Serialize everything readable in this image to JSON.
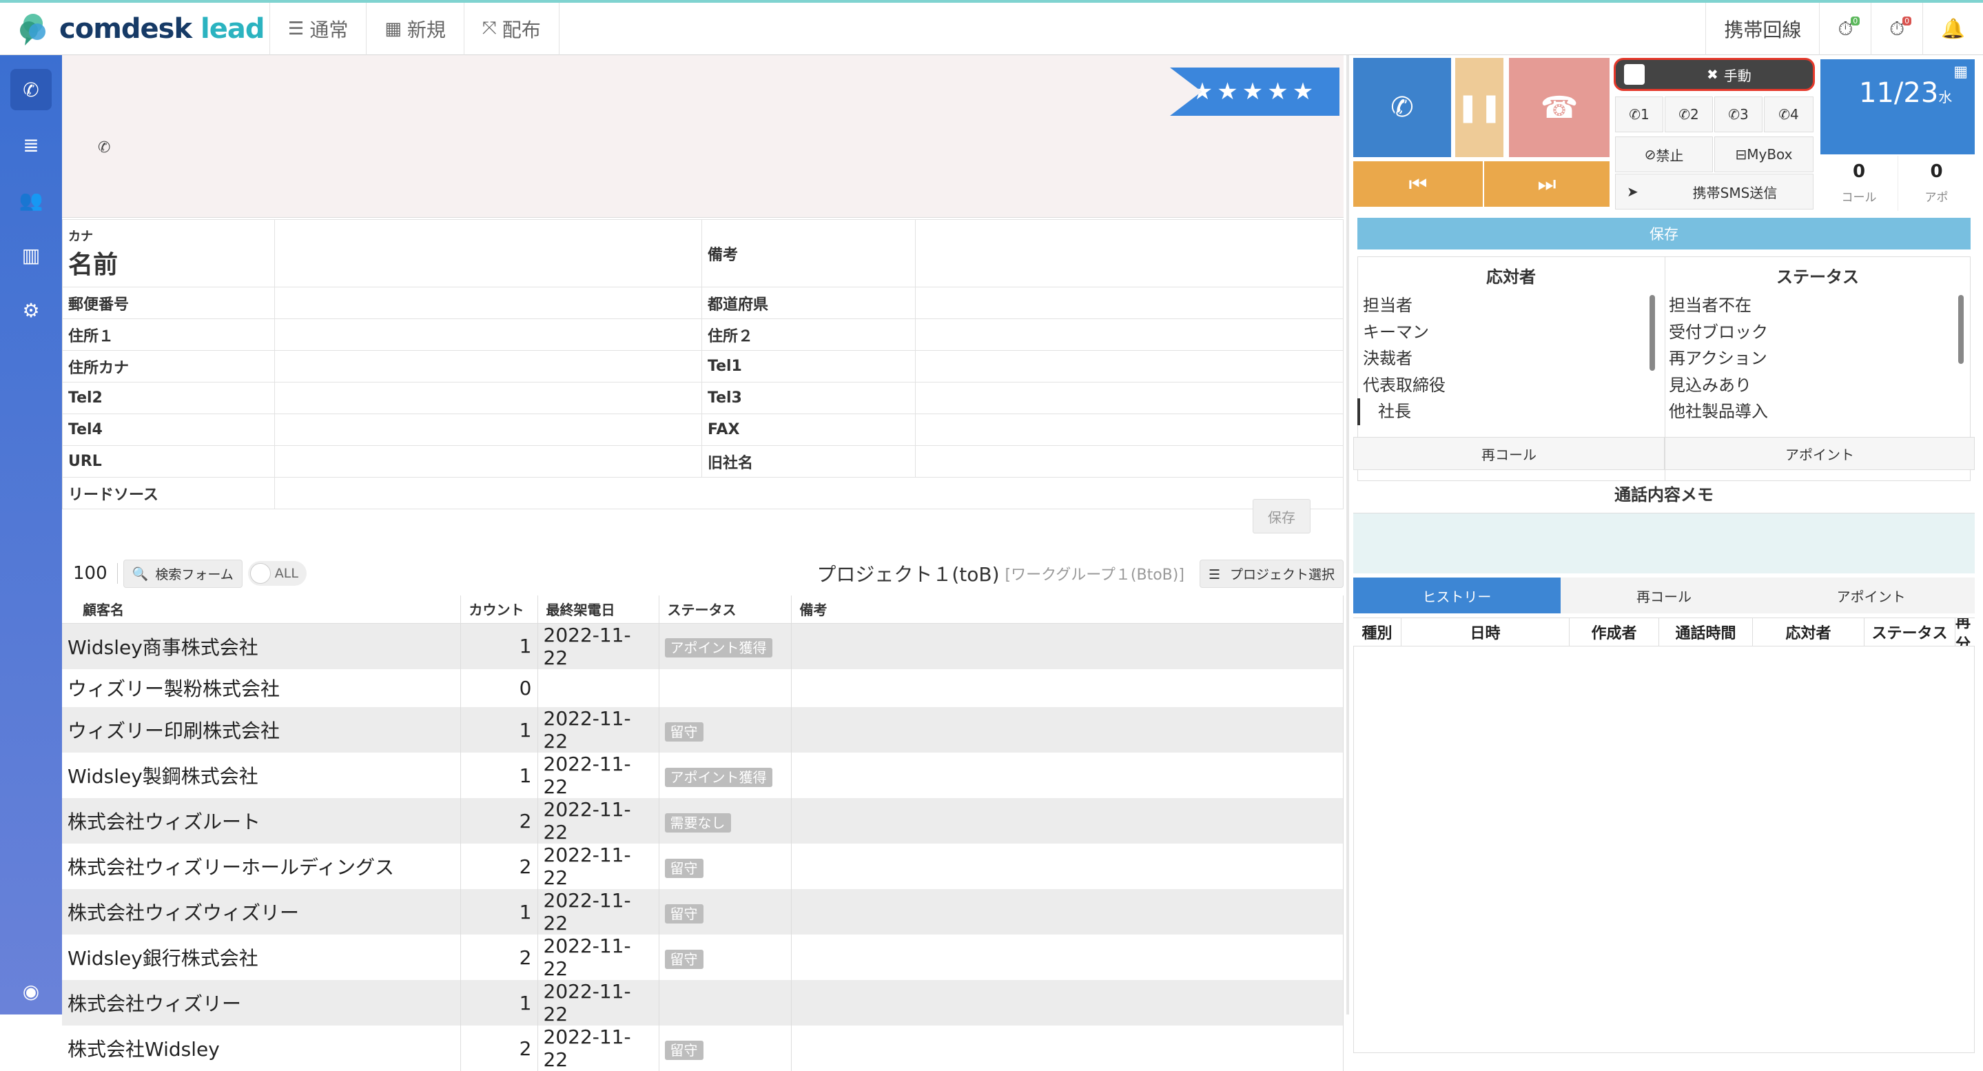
{
  "topbar": {
    "logo_word1": "comdesk",
    "logo_word2": "lead",
    "nav": [
      {
        "label": "通常",
        "icon": "list-icon"
      },
      {
        "label": "新規",
        "icon": "grid-icon"
      },
      {
        "label": "配布",
        "icon": "expand-icon"
      }
    ],
    "line_label": "携帯回線"
  },
  "banner": {
    "stars": "★★★★★"
  },
  "customer": {
    "kana_label": "カナ",
    "name_label": "名前",
    "fields_left": [
      "郵便番号",
      "住所１",
      "住所カナ",
      "Tel2",
      "Tel4",
      "URL",
      "リードソース"
    ],
    "fields_right": [
      "備考",
      "都道府県",
      "住所２",
      "Tel1",
      "Tel3",
      "FAX",
      "旧社名"
    ],
    "save_label": "保存"
  },
  "list": {
    "count": "100",
    "search_label": "検索フォーム",
    "toggle_label": "ALL",
    "project_title": "プロジェクト１(toB)",
    "project_sub": "[ワークグループ１(BtoB)]",
    "project_select": "プロジェクト選択",
    "headers": [
      "顧客名",
      "カウント",
      "最終架電日",
      "ステータス",
      "備考"
    ],
    "rows": [
      {
        "name": "Widsley商事株式会社",
        "count": "1",
        "date": "2022-11-22",
        "status": "アポイント獲得"
      },
      {
        "name": "ウィズリー製粉株式会社",
        "count": "0",
        "date": "",
        "status": ""
      },
      {
        "name": "ウィズリー印刷株式会社",
        "count": "1",
        "date": "2022-11-22",
        "status": "留守"
      },
      {
        "name": "Widsley製鋼株式会社",
        "count": "1",
        "date": "2022-11-22",
        "status": "アポイント獲得"
      },
      {
        "name": "株式会社ウィズルート",
        "count": "2",
        "date": "2022-11-22",
        "status": "需要なし"
      },
      {
        "name": "株式会社ウィズリーホールディングス",
        "count": "2",
        "date": "2022-11-22",
        "status": "留守"
      },
      {
        "name": "株式会社ウィズウィズリー",
        "count": "1",
        "date": "2022-11-22",
        "status": "留守"
      },
      {
        "name": "Widsley銀行株式会社",
        "count": "2",
        "date": "2022-11-22",
        "status": "留守"
      },
      {
        "name": "株式会社ウィズリー",
        "count": "1",
        "date": "2022-11-22",
        "status": ""
      },
      {
        "name": "株式会社Widsley",
        "count": "2",
        "date": "2022-11-22",
        "status": "留守"
      }
    ]
  },
  "phone": {
    "manual_label": "手動",
    "lines": [
      "1",
      "2",
      "3",
      "4"
    ],
    "ban_label": "禁止",
    "mybox_label": "MyBox",
    "sms_label": "携帯SMS送信",
    "date_label": "11/23",
    "weekday_label": "水",
    "call_count": "0",
    "call_label": "コール",
    "appo_count": "0",
    "appo_label": "アポ",
    "save_label": "保存",
    "responder_title": "応対者",
    "responders": [
      "担当者",
      "キーマン",
      "決裁者",
      "代表取締役",
      "社長"
    ],
    "status_title": "ステータス",
    "statuses": [
      "担当者不在",
      "受付ブロック",
      "再アクション",
      "見込みあり",
      "他社製品導入"
    ],
    "recall_label": "再コール",
    "appoint_label": "アポイント",
    "memo_title": "通話内容メモ",
    "tabs": [
      "ヒストリー",
      "再コール",
      "アポイント"
    ],
    "history_headers": [
      "種別",
      "日時",
      "作成者",
      "通話時間",
      "応対者",
      "ステータス",
      "再分"
    ]
  },
  "colors": {
    "accent": "#3a84d3",
    "hangup": "#e59b95",
    "pause": "#eecb97",
    "nav": "#eaa84b"
  }
}
